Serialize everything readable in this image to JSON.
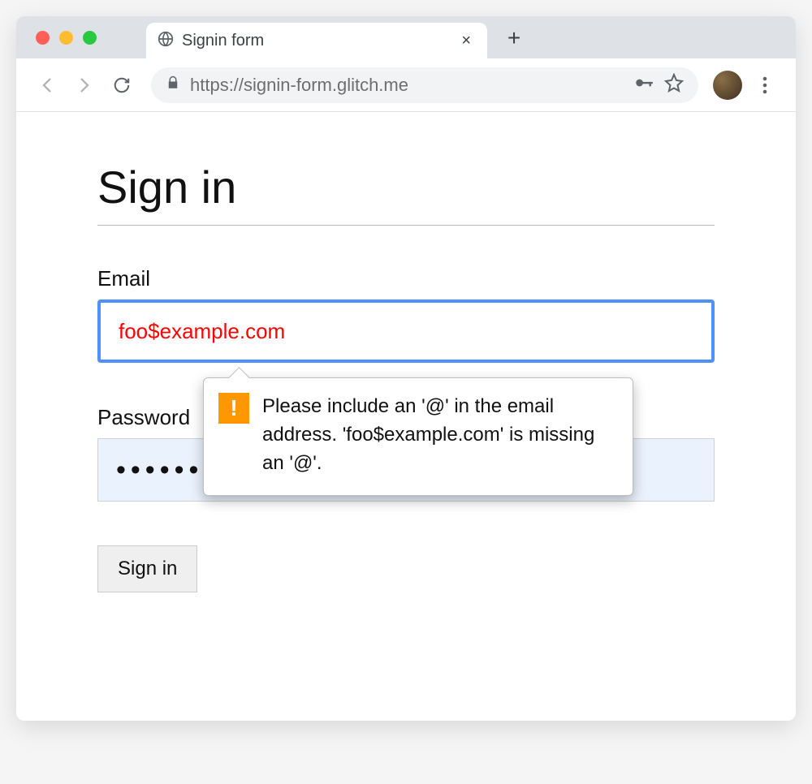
{
  "browser": {
    "tab_title": "Signin form",
    "url": "https://signin-form.glitch.me"
  },
  "page": {
    "heading": "Sign in",
    "email_label": "Email",
    "email_value": "foo$example.com",
    "password_label": "Password",
    "password_value": "••••••••••",
    "submit_label": "Sign in"
  },
  "validation": {
    "message": "Please include an '@' in the email address. 'foo$example.com' is missing an '@'."
  }
}
